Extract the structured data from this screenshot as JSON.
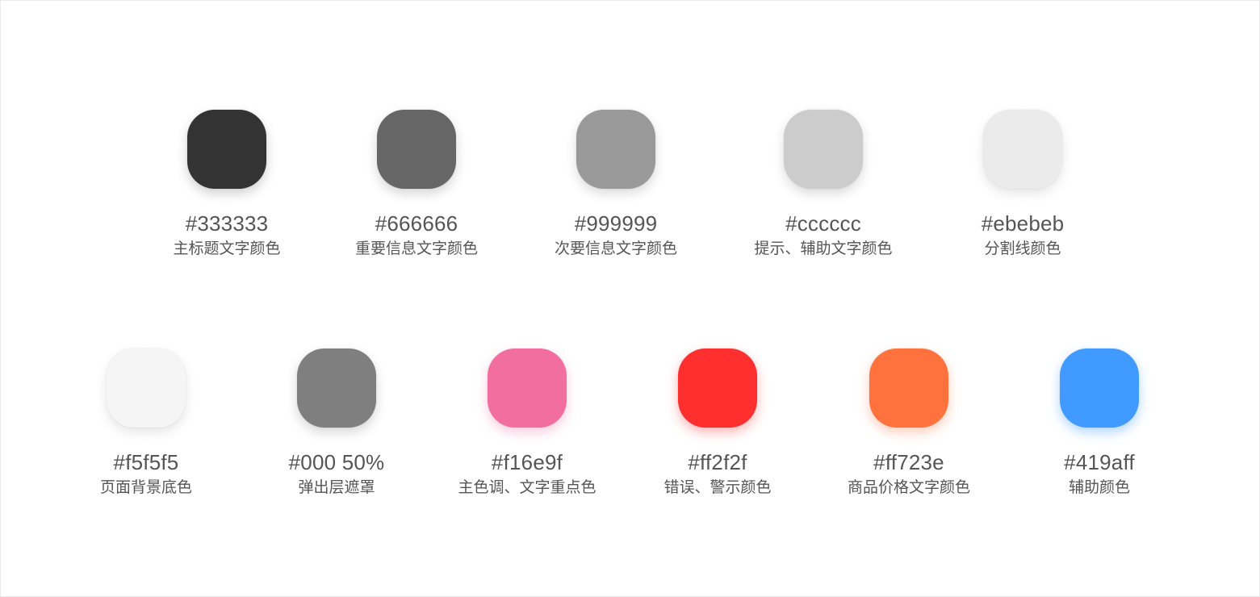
{
  "row1": [
    {
      "hex": "#333333",
      "label": "主标题文字颜色",
      "color": "#333333",
      "shadow": "rgba(0,0,0,0.18)"
    },
    {
      "hex": "#666666",
      "label": "重要信息文字颜色",
      "color": "#666666",
      "shadow": "rgba(0,0,0,0.16)"
    },
    {
      "hex": "#999999",
      "label": "次要信息文字颜色",
      "color": "#999999",
      "shadow": "rgba(0,0,0,0.14)"
    },
    {
      "hex": "#cccccc",
      "label": "提示、辅助文字颜色",
      "color": "#cccccc",
      "shadow": "rgba(0,0,0,0.14)"
    },
    {
      "hex": "#ebebeb",
      "label": "分割线颜色",
      "color": "#ebebeb",
      "shadow": "rgba(0,0,0,0.10)"
    }
  ],
  "row2": [
    {
      "hex": "#f5f5f5",
      "label": "页面背景底色",
      "color": "#f5f5f5",
      "shadow": "rgba(0,0,0,0.10)"
    },
    {
      "hex": "#000 50%",
      "label": "弹出层遮罩",
      "color": "#7f7f7f",
      "shadow": "rgba(0,0,0,0.16)"
    },
    {
      "hex": "#f16e9f",
      "label": "主色调、文字重点色",
      "color": "#f16e9f",
      "shadow": "rgba(241,110,159,0.35)"
    },
    {
      "hex": "#ff2f2f",
      "label": "错误、警示颜色",
      "color": "#ff2f2f",
      "shadow": "rgba(255,47,47,0.35)"
    },
    {
      "hex": "#ff723e",
      "label": "商品价格文字颜色",
      "color": "#ff723e",
      "shadow": "rgba(255,114,62,0.35)"
    },
    {
      "hex": "#419aff",
      "label": "辅助颜色",
      "color": "#419aff",
      "shadow": "rgba(65,154,255,0.40)"
    }
  ]
}
